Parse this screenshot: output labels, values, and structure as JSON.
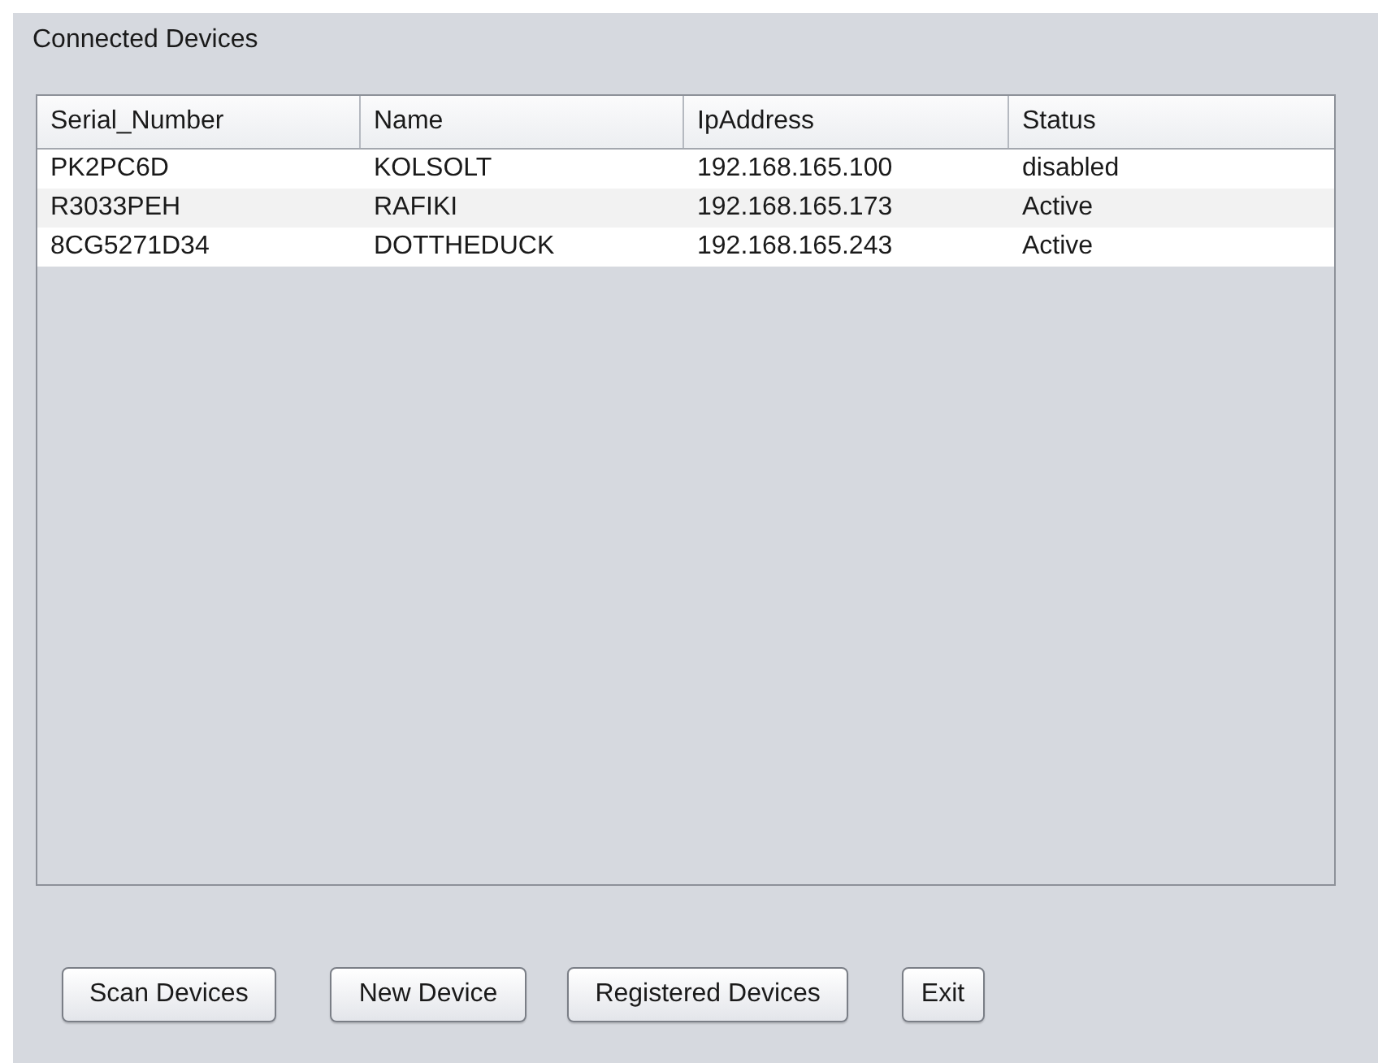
{
  "panel": {
    "title": "Connected Devices"
  },
  "table": {
    "columns": [
      "Serial_Number",
      "Name",
      "IpAddress",
      "Status"
    ],
    "rows": [
      [
        "PK2PC6D",
        "KOLSOLT",
        "192.168.165.100",
        "disabled"
      ],
      [
        "R3033PEH",
        "RAFIKI",
        "192.168.165.173",
        "Active"
      ],
      [
        "8CG5271D34",
        "DOTTHEDUCK",
        "192.168.165.243",
        "Active"
      ]
    ]
  },
  "buttons": [
    "Scan Devices",
    "New Device",
    "Registered Devices",
    "Exit"
  ]
}
